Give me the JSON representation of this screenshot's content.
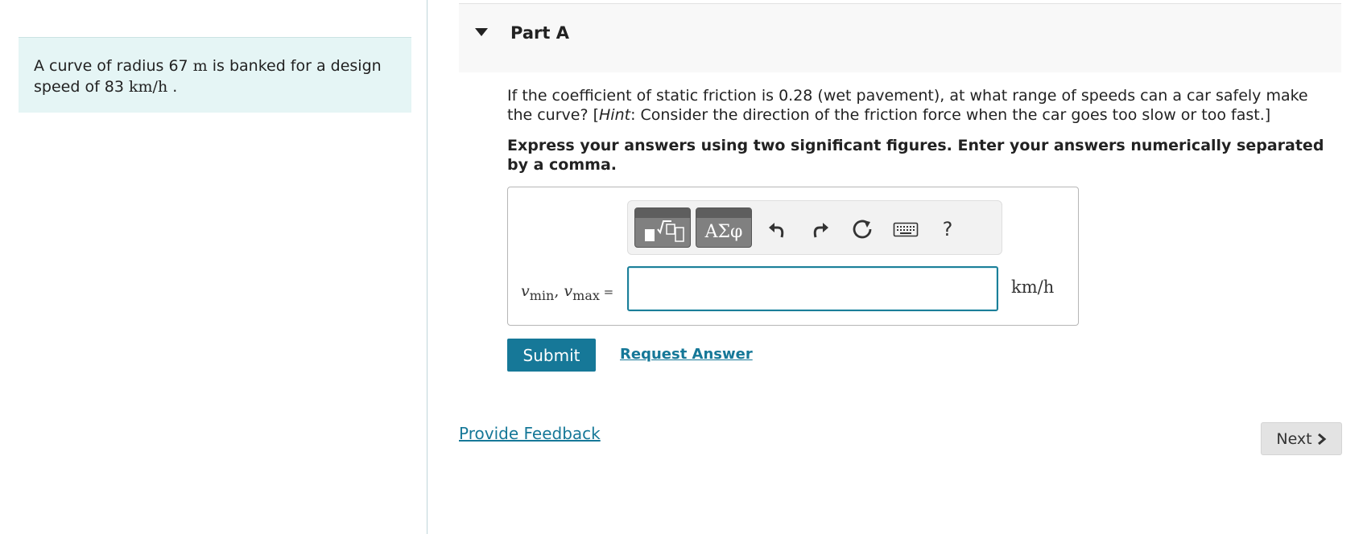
{
  "problem": {
    "text_before_radius": "A curve of radius 67 ",
    "radius_unit": "m",
    "text_after_radius": " is banked for a design speed of 83 ",
    "speed_unit": "km/h",
    "text_end": " ."
  },
  "part": {
    "title": "Part A"
  },
  "question": {
    "text_main": "If the coefficient of static friction is 0.28 (wet pavement), at what range of speeds can a car safely make the curve? [",
    "hint_label": "Hint",
    "hint_text": ": Consider the direction of the friction force when the car goes too slow or too fast.]"
  },
  "instructions": "Express your answers using two significant figures. Enter your answers numerically separated by a comma.",
  "answer": {
    "var_v": "v",
    "var_min": "min",
    "comma": ", ",
    "var_max": "max",
    "equals": " =",
    "value": "",
    "unit": "km/h"
  },
  "toolbar": {
    "templates_icon": "templates-icon",
    "greek_label": "ΑΣφ",
    "undo_icon": "undo-icon",
    "redo_icon": "redo-icon",
    "reset_icon": "reset-icon",
    "keyboard_icon": "keyboard-icon",
    "help_label": "?"
  },
  "actions": {
    "submit_label": "Submit",
    "request_answer_label": "Request Answer",
    "feedback_label": "Provide Feedback",
    "next_label": "Next"
  },
  "colors": {
    "accent": "#167898",
    "problem_bg": "#e5f5f5",
    "header_bg": "#f8f8f8",
    "next_bg": "#e3e3e3"
  }
}
